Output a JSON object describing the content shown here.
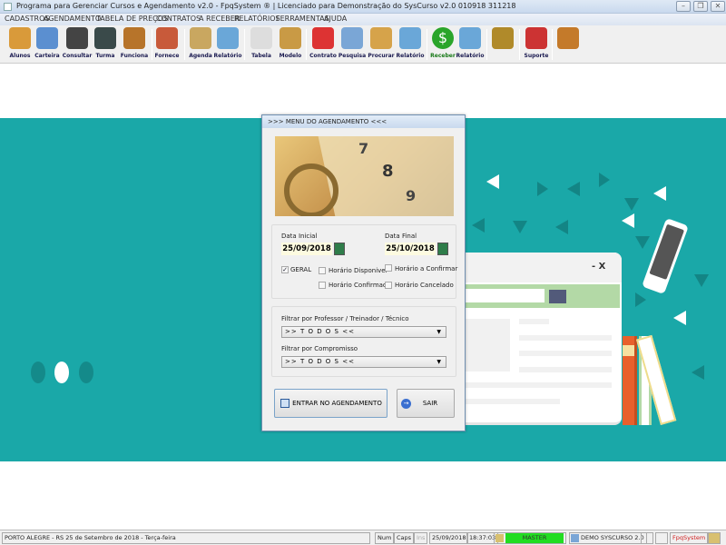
{
  "window": {
    "title": "Programa para Gerenciar Cursos e Agendamento v2.0 - FpqSystem ® | Licenciado para  Demonstração do SysCurso v2.0 010918 311218",
    "controls": [
      "minimize",
      "restore",
      "close"
    ]
  },
  "menu": [
    "CADASTROS",
    "AGENDAMENTO",
    "TABELA DE PREÇOS",
    "CONTRATOS",
    "A RECEBER",
    "RELATÓRIOS",
    "FERRAMENTAS",
    "AJUDA"
  ],
  "toolbar": [
    {
      "label": "Alunos",
      "icon": "students-icon",
      "color": "#d99a3a"
    },
    {
      "label": "Carteira",
      "icon": "id-card-icon",
      "color": "#5b8fd0"
    },
    {
      "label": "Consultar",
      "icon": "id-lookup-icon",
      "color": "#444444"
    },
    {
      "label": "Turma",
      "icon": "monitor-icon",
      "color": "#3a4a4a"
    },
    {
      "label": "Funciona",
      "icon": "employees-icon",
      "color": "#b7742a"
    },
    {
      "label": "Fornece",
      "icon": "supplier-icon",
      "color": "#c85a3a"
    },
    {
      "label": "Agenda",
      "icon": "calendar-clock-icon",
      "color": "#c9a760"
    },
    {
      "label": "Relatório",
      "icon": "printer-icon",
      "color": "#6aa7d8"
    },
    {
      "label": "Tabela",
      "icon": "document-icon",
      "color": "#dddddd"
    },
    {
      "label": "Modelo",
      "icon": "scroll-icon",
      "color": "#c99a45"
    },
    {
      "label": "Contrato",
      "icon": "pen-icon",
      "color": "#d33"
    },
    {
      "label": "Pesquisa",
      "icon": "search-docs-icon",
      "color": "#7aa6d6"
    },
    {
      "label": "Procurar",
      "icon": "file-box-icon",
      "color": "#d6a34a"
    },
    {
      "label": "Relatório",
      "icon": "printer-icon",
      "color": "#6aa7d8"
    },
    {
      "label": "Receber",
      "icon": "dollar-icon",
      "color": "#2aa52a"
    },
    {
      "label": "Relatório",
      "icon": "printer-icon",
      "color": "#6aa7d8"
    },
    {
      "label": "",
      "icon": "coins-icon",
      "color": "#b08a2a"
    },
    {
      "label": "Suporte",
      "icon": "support-icon",
      "color": "#c33"
    },
    {
      "label": "",
      "icon": "exit-door-icon",
      "color": "#c47a2a"
    }
  ],
  "illustration": {
    "window_controls": "-  X"
  },
  "dialog": {
    "title": ">>>  MENU DO AGENDAMENTO  <<<",
    "data_inicial_label": "Data Inicial",
    "data_inicial": "25/09/2018",
    "data_final_label": "Data Final",
    "data_final": "25/10/2018",
    "checkboxes": [
      {
        "label": "GERAL",
        "checked": true
      },
      {
        "label": "Horário  Disponivel",
        "checked": false
      },
      {
        "label": "Horário a Confirmar",
        "checked": false
      },
      {
        "label": "Horário Confirmado",
        "checked": false
      },
      {
        "label": "Horário Cancelado",
        "checked": false
      }
    ],
    "filter_professor_label": "Filtrar por Professor / Treinador / Técnico",
    "filter_professor_value": ">> T O D O S <<",
    "filter_compromisso_label": "Filtrar por Compromisso",
    "filter_compromisso_value": ">> T O D O S <<",
    "enter_button": "ENTRAR NO AGENDAMENTO",
    "exit_button": "SAIR"
  },
  "status": {
    "location": "PORTO ALEGRE - RS 25 de Setembro de 2018 - Terça-feira",
    "num": "Num",
    "caps": "Caps",
    "ins": "Ins",
    "date": "25/09/2018",
    "time": "18:37:03",
    "user": "MASTER",
    "company": "DEMO SYSCURSO 2.0",
    "brand": "FpqSystem",
    "user_color": "#22dd22"
  }
}
